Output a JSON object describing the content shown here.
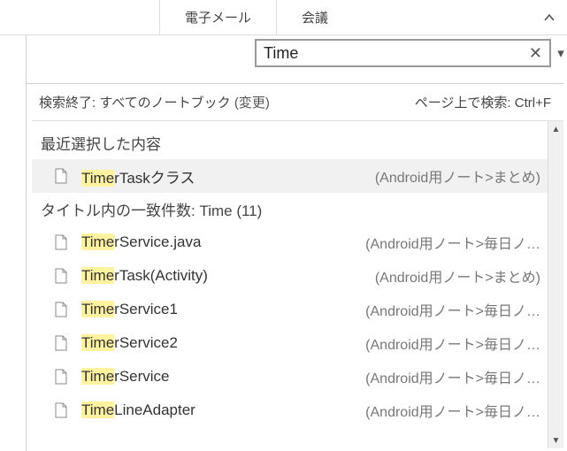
{
  "toolbar": {
    "tab_email": "電子メール",
    "tab_meeting": "会議"
  },
  "search": {
    "query": "Time"
  },
  "status": {
    "done_prefix": "検索終了: すべてのノートブック ",
    "done_change": "(変更)",
    "find_on_page": "ページ上で検索: Ctrl+F"
  },
  "sections": {
    "recent_header": "最近選択した内容",
    "title_matches_prefix": "タイトル内の一致件数: ",
    "title_matches_term": "Time",
    "title_matches_count": " (11)"
  },
  "recent": [
    {
      "hl": "Time",
      "rest": "rTaskクラス",
      "path": "(Android用ノート>まとめ)"
    }
  ],
  "results": [
    {
      "hl": "Time",
      "rest": "rService.java",
      "path": "(Android用ノート>毎日ノ…"
    },
    {
      "hl": "Time",
      "rest": "rTask(Activity)",
      "path": "(Android用ノート>まとめ)"
    },
    {
      "hl": "Time",
      "rest": "rService1",
      "path": "(Android用ノート>毎日ノ…"
    },
    {
      "hl": "Time",
      "rest": "rService2",
      "path": "(Android用ノート>毎日ノ…"
    },
    {
      "hl": "Time",
      "rest": "rService",
      "path": "(Android用ノート>毎日ノ…"
    },
    {
      "hl": "Time",
      "rest": "LineAdapter",
      "path": "(Android用ノート>毎日ノ…"
    }
  ]
}
